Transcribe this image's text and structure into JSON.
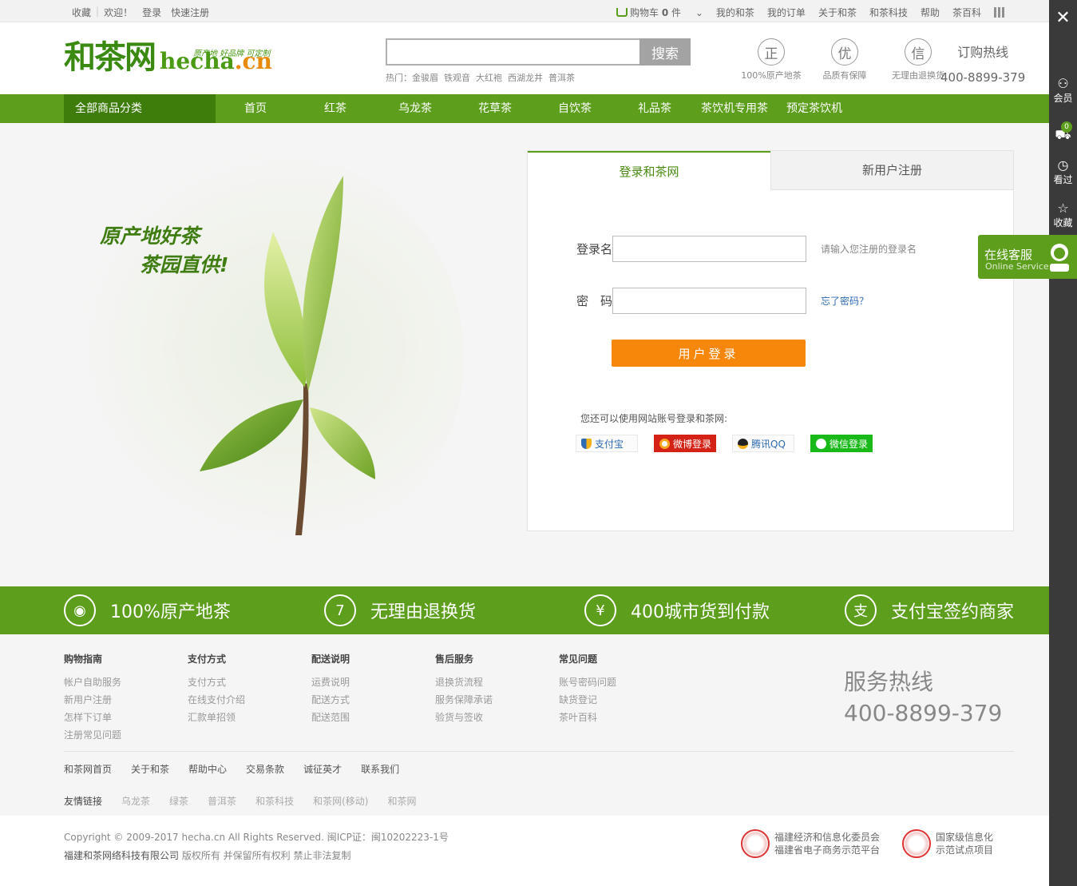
{
  "topbar": {
    "left": [
      "收藏",
      "欢迎！",
      "登录",
      "快速注册"
    ],
    "cart_label": "购物车",
    "cart_count": "0",
    "cart_unit": "件",
    "links": [
      "我的和茶",
      "我的订单",
      "关于和茶",
      "和茶科技",
      "帮助",
      "茶百科"
    ]
  },
  "logo": {
    "cn": "和茶网",
    "en_main": "hecha",
    "en_tld": ".cn",
    "slogan": "原产地 好品牌 可定制"
  },
  "search": {
    "placeholder": "",
    "button": "搜索",
    "hot_label": "热门：",
    "hot": [
      "金骏眉",
      "铁观音",
      "大红袍",
      "西湖龙井",
      "普洱茶"
    ]
  },
  "badges": [
    {
      "glyph": "正",
      "label": "100%原产地茶"
    },
    {
      "glyph": "优",
      "label": "品质有保障"
    },
    {
      "glyph": "信",
      "label": "无理由退换货"
    }
  ],
  "hotline": {
    "title": "订购热线",
    "number": "400-8899-379"
  },
  "nav": {
    "category": "全部商品分类",
    "items": [
      "首页",
      "红茶",
      "乌龙茶",
      "花草茶",
      "自饮茶",
      "礼品茶",
      "茶饮机专用茶",
      "预定茶饮机"
    ]
  },
  "hero": {
    "line1": "原产地好茶",
    "line2": "茶园直供!"
  },
  "login": {
    "tab_login": "登录和茶网",
    "tab_register": "新用户注册",
    "username_label": "登录名",
    "username_hint": "请输入您注册的登录名",
    "password_label": "密　码",
    "forgot": "忘了密码？",
    "submit": "用户登录",
    "other_text": "您还可以使用网站账号登录和茶网:",
    "social": [
      "支付宝",
      "微博登录",
      "腾讯QQ",
      "微信登录"
    ]
  },
  "features": [
    "100%原产地茶",
    "无理由退换货",
    "400城市货到付款",
    "支付宝签约商家"
  ],
  "footer": {
    "columns": [
      {
        "title": "购物指南",
        "items": [
          "帐户自助服务",
          "新用户注册",
          "怎样下订单",
          "注册常见问题"
        ]
      },
      {
        "title": "支付方式",
        "items": [
          "支付方式",
          "在线支付介绍",
          "汇款单招领"
        ]
      },
      {
        "title": "配送说明",
        "items": [
          "运费说明",
          "配送方式",
          "配送范围"
        ]
      },
      {
        "title": "售后服务",
        "items": [
          "退换货流程",
          "服务保障承诺",
          "验货与签收"
        ]
      },
      {
        "title": "常见问题",
        "items": [
          "账号密码问题",
          "缺货登记",
          "茶叶百科"
        ]
      }
    ],
    "hotline_title": "服务热线",
    "hotline_number": "400-8899-379",
    "links": [
      "和茶网首页",
      "关于和茶",
      "帮助中心",
      "交易条款",
      "诚征英才",
      "联系我们"
    ],
    "friends_label": "友情链接",
    "friends": [
      "乌龙茶",
      "绿茶",
      "普洱茶",
      "和茶科技",
      "和茶网(移动)",
      "和茶网"
    ]
  },
  "copyright": {
    "line1": "Copyright © 2009-2017 hecha.cn All Rights Reserved. 闽ICP证：闽10202223-1号",
    "company": "福建和茶网络科技有限公司",
    "rights": "版权所有 并保留所有权利 禁止非法复制",
    "cert1": [
      "福建经济和信息化委员会",
      "福建省电子商务示范平台"
    ],
    "cert2": [
      "国家级信息化",
      "示范试点项目"
    ]
  },
  "sidebar": {
    "member": "会员",
    "cart_count": "0",
    "viewed": "看过",
    "favorite": "收藏"
  },
  "online_service": {
    "title": "在线客服",
    "subtitle": "Online Service"
  },
  "colors": {
    "brand_green": "#5d9e1c",
    "dark_green": "#3e7d0b",
    "orange": "#f7870b",
    "sidebar": "#3a3a3a"
  }
}
